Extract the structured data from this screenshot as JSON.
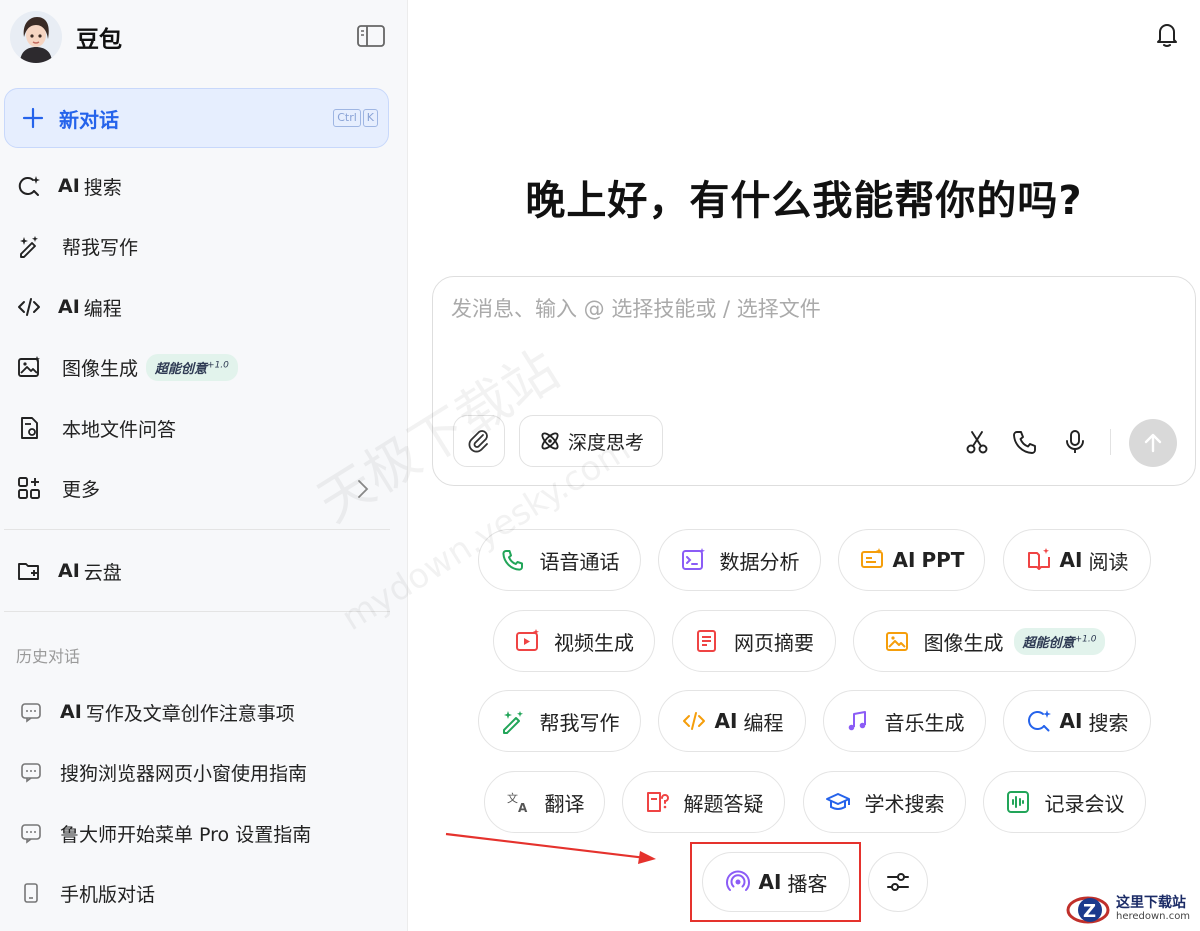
{
  "app": {
    "name": "豆包"
  },
  "new_chat": {
    "label": "新对话",
    "kbd": [
      "Ctrl",
      "K"
    ]
  },
  "nav": [
    {
      "ai": "AI",
      "label": "搜索",
      "icon": "search-sparkle-icon"
    },
    {
      "ai": "",
      "label": "帮我写作",
      "icon": "pen-sparkle-icon"
    },
    {
      "ai": "AI",
      "label": "编程",
      "icon": "code-icon"
    },
    {
      "ai": "",
      "label": "图像生成",
      "icon": "image-icon",
      "badge": "超能创意",
      "badge_sup": "+1.0"
    },
    {
      "ai": "",
      "label": "本地文件问答",
      "icon": "file-icon"
    },
    {
      "ai": "",
      "label": "更多",
      "icon": "apps-icon"
    }
  ],
  "cloud": {
    "ai": "AI",
    "label": "云盘"
  },
  "history": {
    "title": "历史对话",
    "items": [
      {
        "ai": "AI",
        "label": "写作及文章创作注意事项",
        "icon": "chat-bubble-icon"
      },
      {
        "ai": "",
        "label": "搜狗浏览器网页小窗使用指南",
        "icon": "chat-bubble-icon"
      },
      {
        "ai": "",
        "label": "鲁大师开始菜单 Pro 设置指南",
        "icon": "chat-bubble-icon"
      },
      {
        "ai": "",
        "label": "手机版对话",
        "icon": "phone-icon"
      }
    ]
  },
  "greeting": "晚上好，有什么我能帮你的吗?",
  "composer": {
    "placeholder": "发消息、输入 @ 选择技能或 / 选择文件",
    "deep_think": "深度思考"
  },
  "chips": [
    {
      "ai": "",
      "label": "语音通话",
      "icon": "phone-icon",
      "color": "#22a559"
    },
    {
      "ai": "",
      "label": "数据分析",
      "icon": "terminal-icon",
      "color": "#8b5cf6"
    },
    {
      "ai": "AI",
      "label": "PPT",
      "icon": "ppt-icon",
      "color": "#f59e0b"
    },
    {
      "ai": "AI",
      "label": "阅读",
      "icon": "book-icon",
      "color": "#ef4444"
    },
    {
      "ai": "",
      "label": "视频生成",
      "icon": "video-icon",
      "color": "#ef4444"
    },
    {
      "ai": "",
      "label": "网页摘要",
      "icon": "doc-icon",
      "color": "#ef4444"
    },
    {
      "ai": "",
      "label": "图像生成",
      "icon": "image-icon",
      "color": "#f59e0b",
      "badge": "超能创意",
      "badge_sup": "+1.0"
    },
    {
      "ai": "",
      "label": "帮我写作",
      "icon": "pen-sparkle-icon",
      "color": "#22a559"
    },
    {
      "ai": "AI",
      "label": "编程",
      "icon": "code-icon",
      "color": "#f59e0b"
    },
    {
      "ai": "",
      "label": "音乐生成",
      "icon": "music-icon",
      "color": "#8b5cf6"
    },
    {
      "ai": "AI",
      "label": "搜索",
      "icon": "search-sparkle-icon",
      "color": "#2563eb"
    },
    {
      "ai": "",
      "label": "翻译",
      "icon": "translate-icon",
      "color": "#555555"
    },
    {
      "ai": "",
      "label": "解题答疑",
      "icon": "question-icon",
      "color": "#ef4444"
    },
    {
      "ai": "",
      "label": "学术搜索",
      "icon": "graduation-cap-icon",
      "color": "#2563eb"
    },
    {
      "ai": "",
      "label": "记录会议",
      "icon": "waveform-icon",
      "color": "#22a559"
    },
    {
      "ai": "AI",
      "label": "播客",
      "icon": "podcast-icon",
      "color": "#8b5cf6"
    }
  ],
  "watermark": {
    "line1": "天极下载站",
    "line2": "mydown.yesky.com"
  },
  "corner_logo": {
    "title": "这里下载站",
    "domain": "heredown.com"
  },
  "colors": {
    "accent": "#2563eb",
    "new_chat_bg": "#e6eefe",
    "highlight": "#e5322d",
    "badge_bg": "#e2f3ec"
  }
}
